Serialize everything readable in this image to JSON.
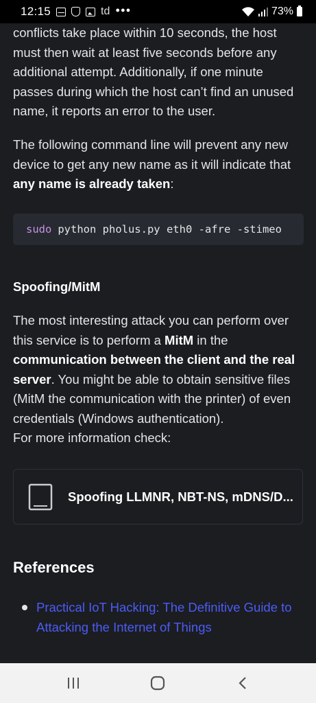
{
  "status_bar": {
    "time": "12:15",
    "carrier_text": "td",
    "battery": "73%"
  },
  "article": {
    "para1": "conflicts take place within 10 seconds, the host must then wait at least five seconds before any additional attempt. Additionally, if one minute passes during which the host can’t find an unused name, it reports an error to the user.",
    "para2_prefix": "The following command line will prevent any new device to get any new name as it will indicate that ",
    "para2_bold": "any name is already taken",
    "para2_suffix": ":",
    "code_keyword": "sudo",
    "code_rest": "python pholus.py eth0 -afre -stimeo",
    "heading_spoofing": "Spoofing/MitM",
    "para3_a": "The most interesting attack you can perform over this service is to perform a ",
    "para3_bold1": "MitM",
    "para3_b": " in the ",
    "para3_bold2": "communication between the client and the real server",
    "para3_c": ". You might be able to obtain sensitive files (MitM the communication with the printer) of even credentials (Windows authentication).",
    "para3_d": "For more information check:",
    "link_card_title": "Spoofing LLMNR, NBT-NS, mDNS/D...",
    "heading_references": "References",
    "references": [
      "Practical IoT Hacking: The Definitive Guide to Attacking the Internet of Things"
    ]
  },
  "colors": {
    "background": "#1b1d21",
    "link": "#4c5cf5",
    "code_keyword": "#c792ea",
    "code_bg": "#272a30"
  }
}
